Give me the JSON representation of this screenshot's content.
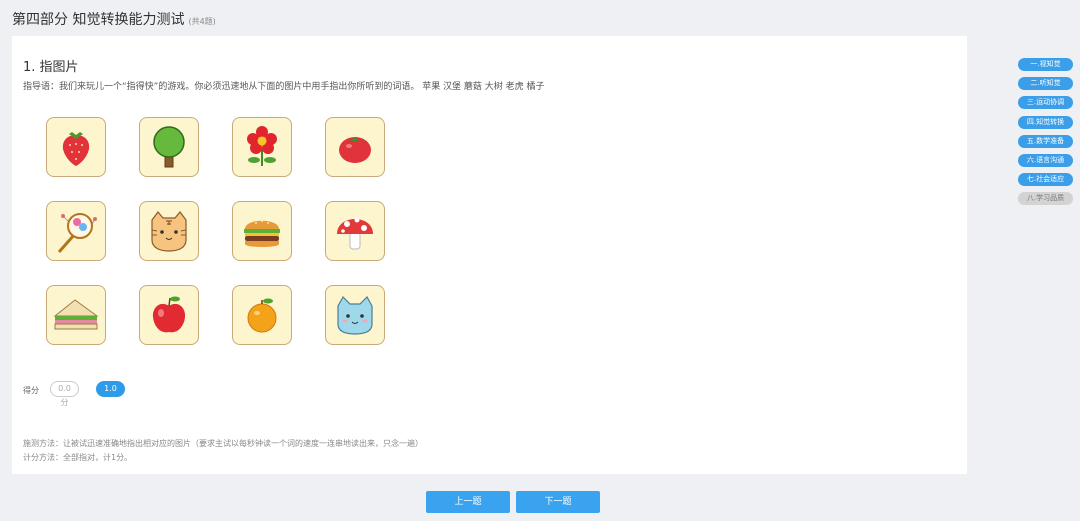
{
  "header": {
    "title": "第四部分 知觉转换能力测试",
    "count": "(共4题)"
  },
  "question": {
    "title": "1. 指图片",
    "guide": "指导语：我们来玩儿一个“指得快”的游戏。你必须迅速地从下面的图片中用手指出你所听到的词语。 苹果 汉堡 蘑菇 大树 老虎 橘子"
  },
  "images": [
    {
      "icon": "strawberry-icon"
    },
    {
      "icon": "tree-icon"
    },
    {
      "icon": "flower-icon"
    },
    {
      "icon": "tomato-icon"
    },
    {
      "icon": "rattle-drum-icon"
    },
    {
      "icon": "tiger-icon"
    },
    {
      "icon": "hamburger-icon"
    },
    {
      "icon": "mushroom-icon"
    },
    {
      "icon": "sandwich-icon"
    },
    {
      "icon": "apple-icon"
    },
    {
      "icon": "orange-icon"
    },
    {
      "icon": "cat-icon"
    }
  ],
  "score": {
    "label": "得分",
    "option0": "0.0分",
    "option1": "1.0分",
    "selected": "1.0分"
  },
  "method": {
    "test": "施测方法：让被试迅速准确地指出相对应的图片（要求主试以每秒钟读一个词的速度一连串地读出来，只念一遍）",
    "scoring": "计分方法：全部指对，计1分。"
  },
  "nav": {
    "prev": "上一题",
    "next": "下一题"
  },
  "sidebar": {
    "items": [
      {
        "label": "一.视知觉",
        "active": true
      },
      {
        "label": "二.听知觉",
        "active": true
      },
      {
        "label": "三.运动协调",
        "active": true
      },
      {
        "label": "四.知觉转换",
        "active": true
      },
      {
        "label": "五.数学准备",
        "active": true
      },
      {
        "label": "六.语言沟通",
        "active": true
      },
      {
        "label": "七.社会适应",
        "active": true
      },
      {
        "label": "八.学习品质",
        "active": false
      }
    ]
  },
  "colors": {
    "accent": "#39a3f0",
    "tile_bg": "#fdf5cd",
    "tile_border": "#c9a978"
  }
}
